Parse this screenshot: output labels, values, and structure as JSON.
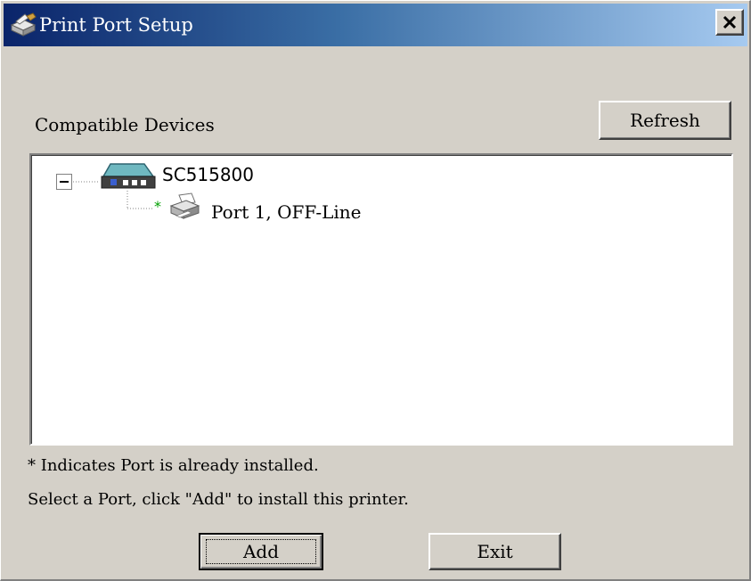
{
  "window": {
    "title": "Print Port Setup",
    "title_icon": "printer-wrench-icon",
    "close_icon": "close-x-icon"
  },
  "devices": {
    "label": "Compatible Devices",
    "refresh_label": "Refresh",
    "tree": [
      {
        "name": "SC515800",
        "icon": "print-server-icon",
        "expanded": true,
        "ports": [
          {
            "installed_marker": "*",
            "label": "Port 1, OFF-Line",
            "icon": "printer-icon"
          }
        ]
      }
    ]
  },
  "notes": {
    "installed": "* Indicates Port is already installed.",
    "instruction": "Select a Port, click \"Add\" to install this printer."
  },
  "actions": {
    "add_label": "Add",
    "exit_label": "Exit"
  },
  "colors": {
    "title_start": "#0a246a",
    "title_end": "#a6caf0",
    "face": "#d4d0c8",
    "installed_marker": "#00a000"
  }
}
